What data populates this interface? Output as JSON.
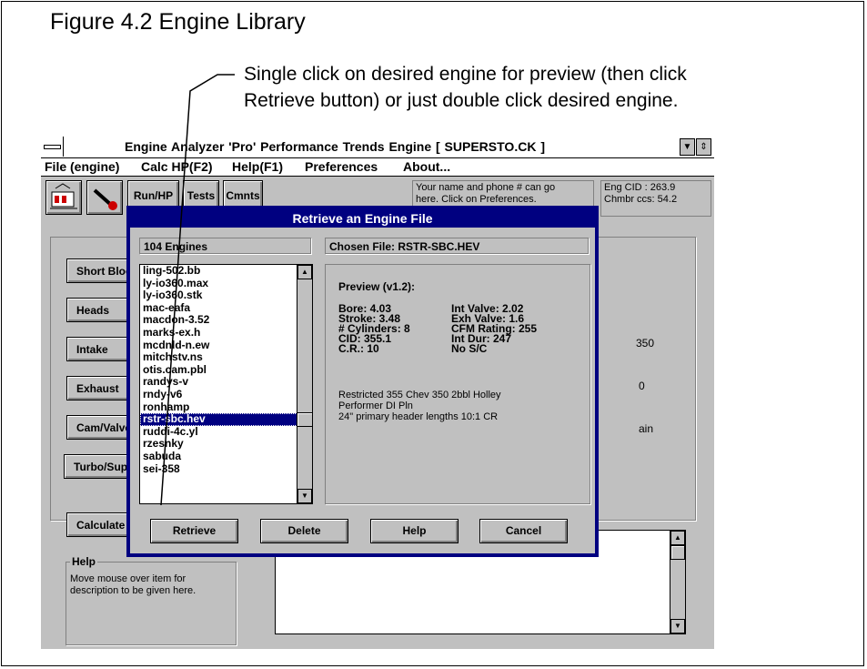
{
  "figure": {
    "title": "Figure 4.2  Engine Library",
    "callout_line1": "Single click on desired engine for preview (then click",
    "callout_line2": "Retrieve button) or just double click desired engine."
  },
  "app": {
    "title": "Engine Analyzer 'Pro'  Performance Trends    Engine [ SUPERSTO.CK ]",
    "menu": [
      "File (engine)",
      "Calc HP(F2)",
      "Help(F1)",
      "Preferences",
      "About..."
    ],
    "toolbar": {
      "run_hp": "Run/HP",
      "tests": "Tests",
      "cmnts": "Cmnts"
    },
    "info_text_1": "Your name and phone # can go",
    "info_text_2": "here.  Click on Preferences.",
    "eng_cid": "Eng CID :  263.9",
    "chmbr_ccs": "Chmbr ccs:  54.2",
    "left_buttons": [
      "Short Block",
      "Heads",
      "Intake",
      "Exhaust",
      "Cam/Valve",
      "Turbo/Super"
    ],
    "calculate_label": "Calculate",
    "peek_350": "350",
    "peek_0": "0",
    "peek_ain": "ain",
    "help_title": "Help",
    "help_text": "Move mouse over item for description to be given here."
  },
  "dialog": {
    "title": "Retrieve an Engine File",
    "count_label": "104 Engines",
    "chosen_file": "Chosen File: RSTR-SBC.HEV",
    "files": [
      "ling-502.bb",
      "ly-io360.max",
      "ly-io360.stk",
      "mac-eafa",
      "macdon-3.52",
      "marks-ex.h",
      "mcdnld-n.ew",
      "mitchstv.ns",
      "otis.cam.pbl",
      "randys-v",
      "rndy-v6",
      "ronhamp",
      "rstr-sbc.hev",
      "ruddi-4c.yl",
      "rzesnky",
      "sabuda",
      "sei-358"
    ],
    "selected_index": 12,
    "preview": {
      "title": "Preview (v1.2):",
      "left": [
        "Bore:  4.03",
        "Stroke:  3.48",
        "# Cylinders:  8",
        "CID:  355.1",
        "C.R.:  10"
      ],
      "right": [
        "Int Valve:  2.02",
        "Exh Valve:  1.6",
        "CFM Rating:  255",
        "Int Dur:  247",
        "No S/C"
      ],
      "note1": "Restricted 355 Chev  350 2bbl Holley",
      "note2": "Performer DI Pln",
      "note3": "24\" primary header lengths  10:1  CR"
    },
    "buttons": {
      "retrieve": "Retrieve",
      "delete": "Delete",
      "help": "Help",
      "cancel": "Cancel"
    }
  }
}
